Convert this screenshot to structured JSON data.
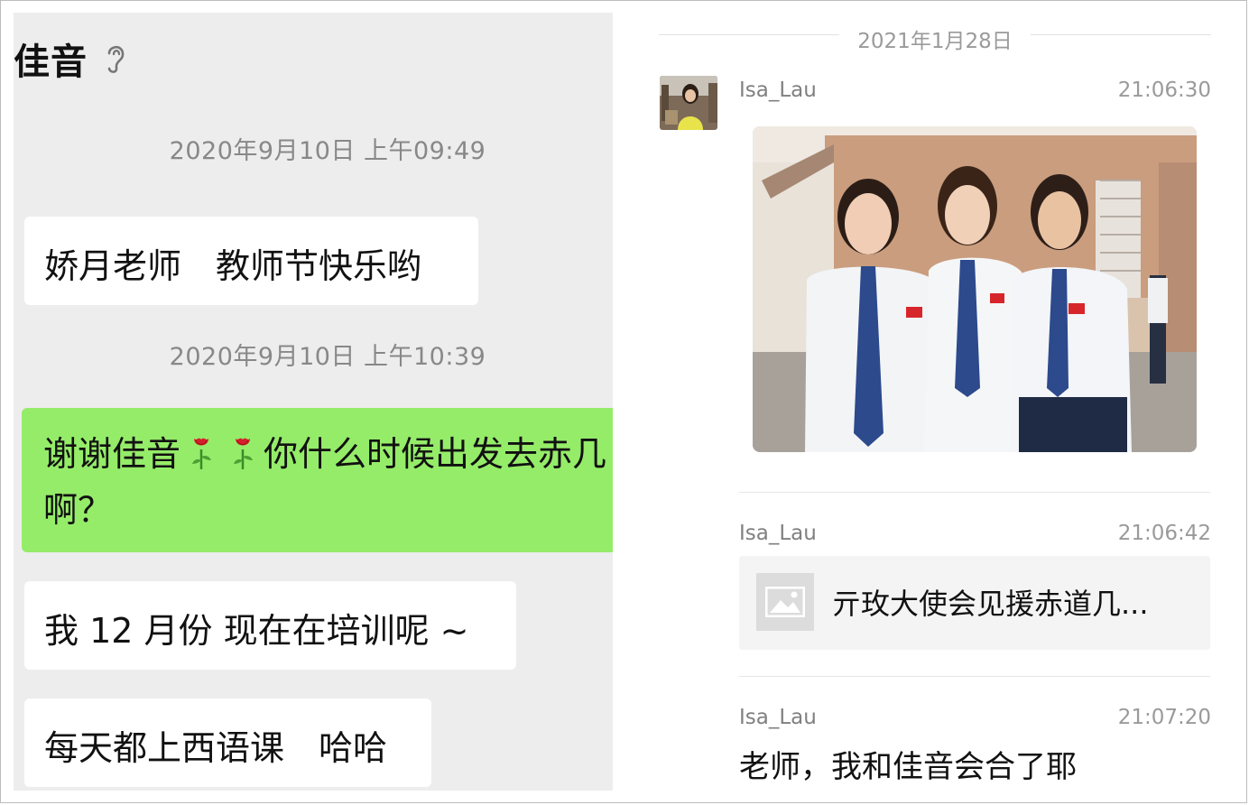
{
  "left_chat": {
    "title": "佳音",
    "messages": [
      {
        "timestamp": "2020年9月10日 上午09:49"
      },
      {
        "text": "娇月老师　教师节快乐哟"
      },
      {
        "timestamp": "2020年9月10日 上午10:39"
      },
      {
        "text_part1": "谢谢佳音",
        "text_part2": "你什么时候出发去赤几啊？"
      },
      {
        "text": "我 12 月份  现在在培训呢 ~"
      },
      {
        "text": "每天都上西语课　哈哈"
      }
    ]
  },
  "right_chat": {
    "date": "2021年1月28日",
    "messages": [
      {
        "sender": "Isa_Lau",
        "time": "21:06:30"
      },
      {
        "sender": "Isa_Lau",
        "time": "21:06:42",
        "link_title": "亓玫大使会见援赤道几..."
      },
      {
        "sender": "Isa_Lau",
        "time": "21:07:20",
        "text": "老师，我和佳音会合了耶"
      }
    ]
  },
  "colors": {
    "self_bubble": "#95ec69",
    "other_bubble": "#ffffff",
    "left_background": "#ededed"
  }
}
